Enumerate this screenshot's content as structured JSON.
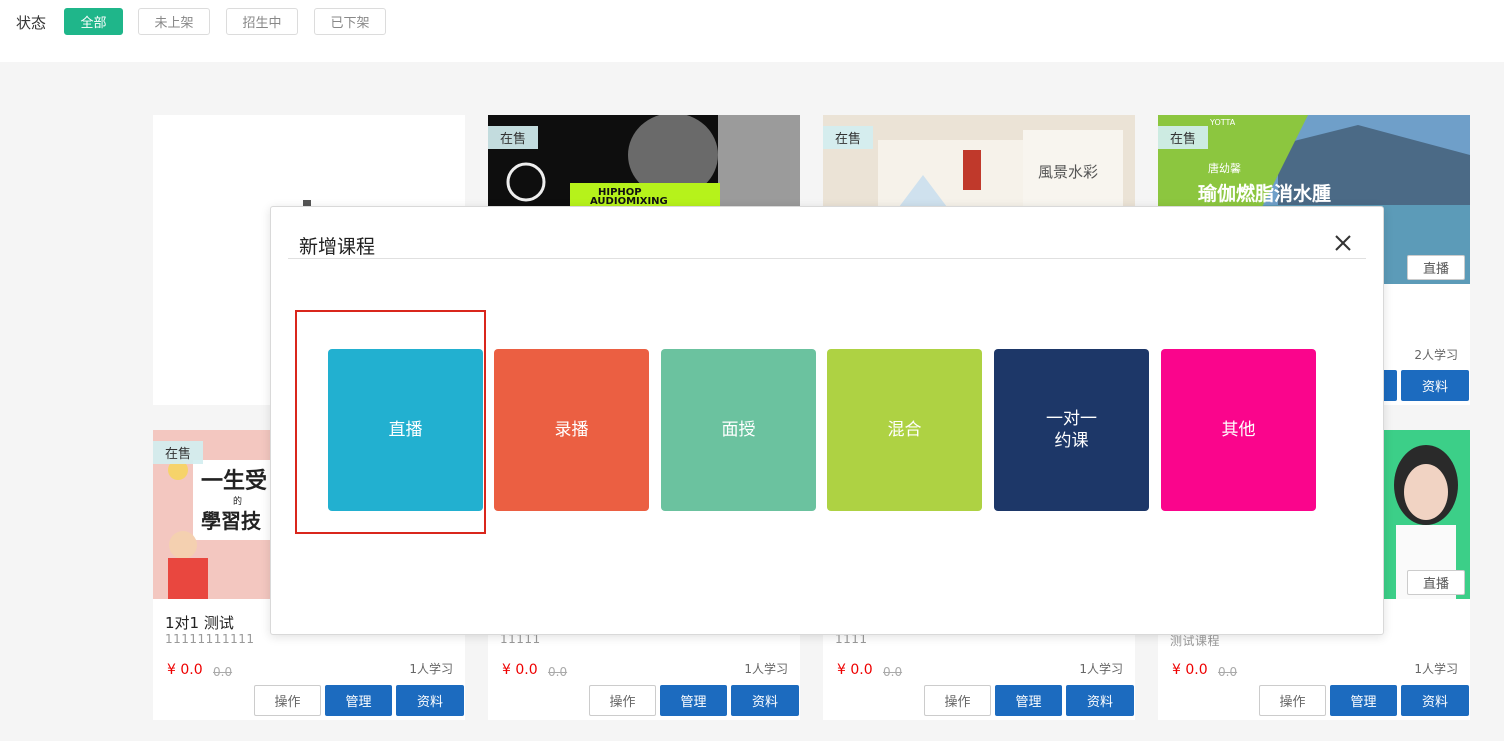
{
  "filter": {
    "label": "状态",
    "chips": [
      "全部",
      "未上架",
      "招生中",
      "已下架"
    ]
  },
  "cards": [
    {
      "status": "",
      "type": "",
      "title": "",
      "desc": "",
      "price": "",
      "old_price": "",
      "learners": ""
    },
    {
      "status": "在售",
      "thumb_text": [
        "HIPHOP",
        "AUDIOMIXING"
      ]
    },
    {
      "status": "在售",
      "thumb_text": [
        "風景水彩"
      ]
    },
    {
      "status": "在售",
      "type": "直播",
      "thumb_text": [
        "YOTTA",
        "瑜伽燃脂消水腫",
        "唐幼馨"
      ],
      "learners": "2人学习",
      "btn_info": "资料"
    },
    {
      "status": "在售",
      "title": "1对1 测试",
      "desc": "11111111111",
      "price": "¥ 0.0",
      "old_price": "0.0",
      "learners": "1人学习",
      "thumb_text": [
        "一生受",
        "的",
        "學習技"
      ]
    },
    {
      "desc": "11111",
      "price": "¥ 0.0",
      "old_price": "0.0",
      "learners": "1人学习"
    },
    {
      "desc": "1111",
      "price": "¥ 0.0",
      "old_price": "0.0",
      "learners": "1人学习"
    },
    {
      "type": "直播",
      "desc": "测试课程",
      "price": "¥ 0.0",
      "old_price": "0.0",
      "learners": "1人学习"
    }
  ],
  "buttons": {
    "op": "操作",
    "manage": "管理",
    "info": "资料"
  },
  "modal": {
    "title": "新增课程",
    "close_icon": "close-icon",
    "types": [
      {
        "label": "直播",
        "color": "#22b0d0"
      },
      {
        "label": "录播",
        "color": "#eb5f42"
      },
      {
        "label": "面授",
        "color": "#6bc29f"
      },
      {
        "label": "混合",
        "color": "#aed243"
      },
      {
        "label": "一对一\n约课",
        "color": "#1d3768"
      },
      {
        "label": "其他",
        "color": "#fa058c"
      }
    ],
    "selected": "直播"
  }
}
